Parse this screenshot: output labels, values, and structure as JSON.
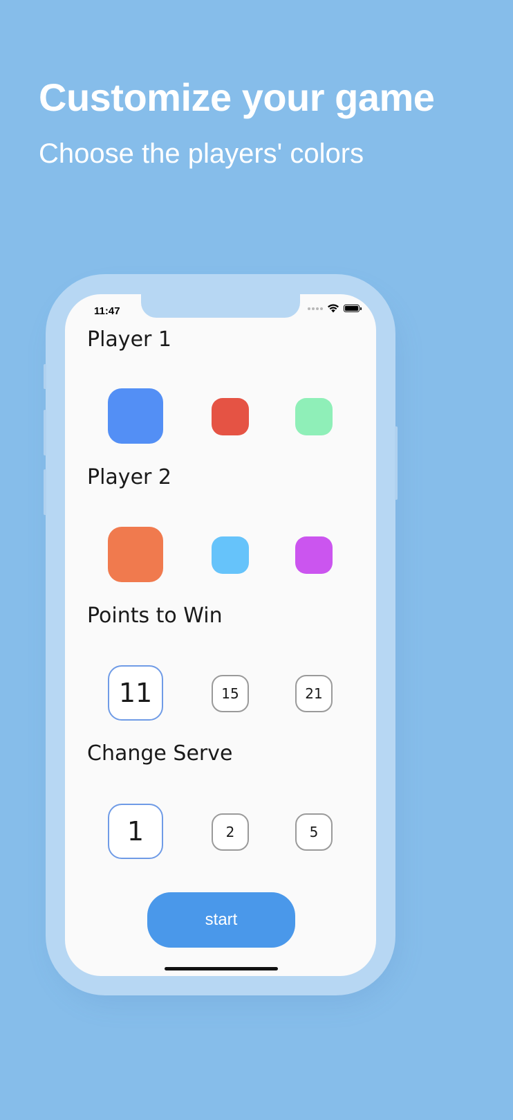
{
  "promo": {
    "headline": "Customize your game",
    "subheadline": "Choose the players' colors"
  },
  "status_bar": {
    "time": "11:47",
    "icons": [
      "signal-dots-icon",
      "wifi-icon",
      "battery-icon"
    ]
  },
  "player1": {
    "label": "Player 1",
    "colors": [
      "#538ff5",
      "#e55344",
      "#8fefb8"
    ],
    "selected_index": 0
  },
  "player2": {
    "label": "Player 2",
    "colors": [
      "#f07a4e",
      "#66c3fa",
      "#cb55ef"
    ],
    "selected_index": 0
  },
  "points_to_win": {
    "label": "Points to Win",
    "options": [
      "11",
      "15",
      "21"
    ],
    "selected_index": 0
  },
  "change_serve": {
    "label": "Change Serve",
    "options": [
      "1",
      "2",
      "5"
    ],
    "selected_index": 0
  },
  "start_button": {
    "label": "start"
  },
  "colors": {
    "background": "#86bdea",
    "device_frame": "#b7d7f3",
    "screen": "#fafafa",
    "accent": "#4a98ea",
    "selected_border": "#6f9be6"
  }
}
